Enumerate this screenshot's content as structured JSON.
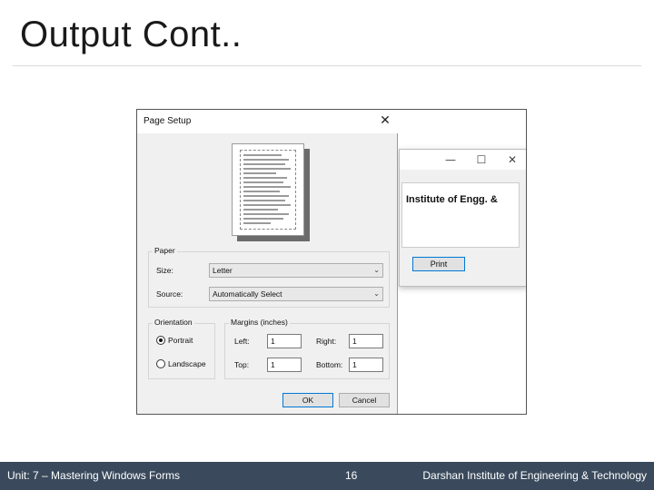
{
  "slide": {
    "title": "Output Cont.."
  },
  "bg_window": {
    "minimize_glyph": "—",
    "maximize_glyph": "☐",
    "close_glyph": "✕",
    "label": "Institute of Engg. &",
    "print_label": "Print"
  },
  "dialog": {
    "title": "Page Setup",
    "close_glyph": "✕",
    "paper": {
      "group_label": "Paper",
      "size_label": "Size:",
      "size_value": "Letter",
      "source_label": "Source:",
      "source_value": "Automatically Select"
    },
    "orientation": {
      "group_label": "Orientation",
      "portrait_label": "Portrait",
      "landscape_label": "Landscape",
      "selected": "Portrait"
    },
    "margins": {
      "group_label": "Margins (inches)",
      "left_label": "Left:",
      "left_value": "1",
      "right_label": "Right:",
      "right_value": "1",
      "top_label": "Top:",
      "top_value": "1",
      "bottom_label": "Bottom:",
      "bottom_value": "1"
    },
    "ok_label": "OK",
    "cancel_label": "Cancel"
  },
  "footer": {
    "unit": "Unit: 7 – Mastering Windows Forms",
    "page_number": "16",
    "institute": "Darshan Institute of Engineering & Technology"
  },
  "colors": {
    "footer_bg": "#3a4a5c",
    "accent": "#0078d7"
  }
}
